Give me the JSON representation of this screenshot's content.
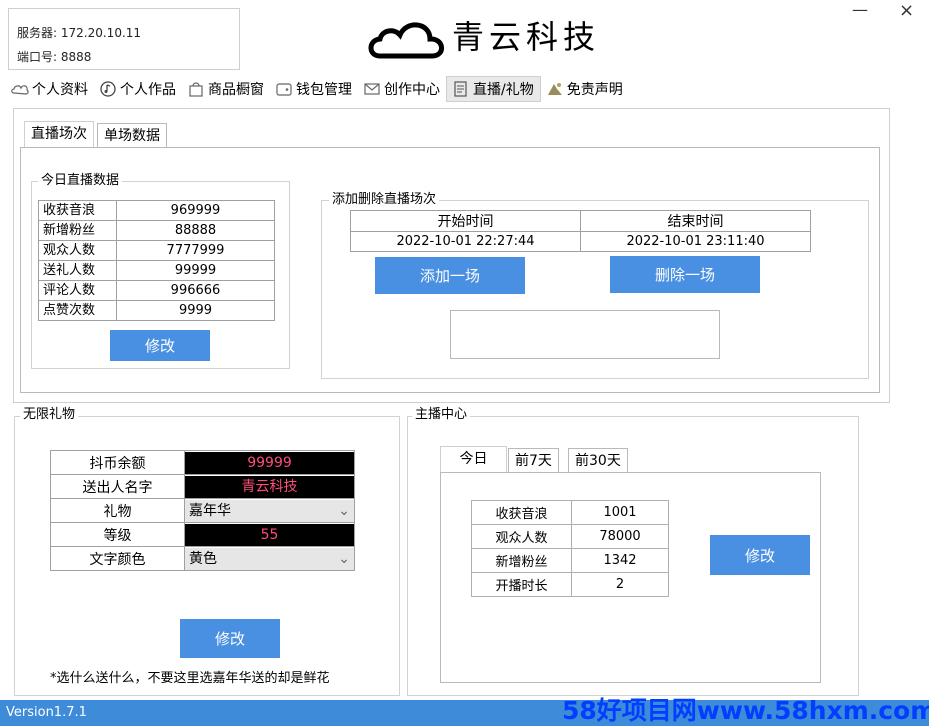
{
  "server": {
    "label": "服务器:",
    "value": "172.20.10.11",
    "port_label": "端口号:",
    "port_value": "8888"
  },
  "app": {
    "brand": "青云科技",
    "minimize": "—",
    "close": "×"
  },
  "tabs": [
    {
      "label": "个人资料",
      "icon": "cloud-icon"
    },
    {
      "label": "个人作品",
      "icon": "music-icon"
    },
    {
      "label": "商品橱窗",
      "icon": "bag-icon"
    },
    {
      "label": "钱包管理",
      "icon": "wallet-icon"
    },
    {
      "label": "创作中心",
      "icon": "mail-icon"
    },
    {
      "label": "直播/礼物",
      "icon": "broadcast-icon"
    },
    {
      "label": "免责声明",
      "icon": "disclaimer-icon"
    }
  ],
  "live": {
    "subtabs": [
      "直播场次",
      "单场数据"
    ],
    "today_title": "今日直播数据",
    "today_rows": [
      {
        "label": "收获音浪",
        "value": "969999"
      },
      {
        "label": "新增粉丝",
        "value": "88888"
      },
      {
        "label": "观众人数",
        "value": "7777999"
      },
      {
        "label": "送礼人数",
        "value": "99999"
      },
      {
        "label": "评论人数",
        "value": "996666"
      },
      {
        "label": "点赞次数",
        "value": "9999"
      }
    ],
    "modify_label": "修改",
    "session_title": "添加删除直播场次",
    "start_header": "开始时间",
    "end_header": "结束时间",
    "start_value": "2022-10-01 22:27:44",
    "end_value": "2022-10-01 23:11:40",
    "add_label": "添加一场",
    "delete_label": "删除一场"
  },
  "gifts": {
    "title": "无限礼物",
    "rows": {
      "balance_label": "抖币余额",
      "balance_value": "99999",
      "sender_label": "送出人名字",
      "sender_value": "青云科技",
      "gift_label": "礼物",
      "gift_value": "嘉年华",
      "level_label": "等级",
      "level_value": "55",
      "color_label": "文字颜色",
      "color_value": "黄色"
    },
    "modify_label": "修改",
    "note": "*选什么送什么，不要这里选嘉年华送的却是鲜花"
  },
  "anchor": {
    "title": "主播中心",
    "tabs": [
      "今日",
      "前7天",
      "前30天"
    ],
    "rows": [
      {
        "label": "收获音浪",
        "value": "1001"
      },
      {
        "label": "观众人数",
        "value": "78000"
      },
      {
        "label": "新增粉丝",
        "value": "1342"
      },
      {
        "label": "开播时长",
        "value": "2"
      }
    ],
    "modify_label": "修改"
  },
  "footer": {
    "version": "Version1.7.1",
    "watermark": "58好项目网www.58hxm.com"
  },
  "colors": {
    "accent": "#4a90e2",
    "footer": "#3d8bd9",
    "watermark": "#003fff",
    "pink_text": "#ff4c79"
  }
}
